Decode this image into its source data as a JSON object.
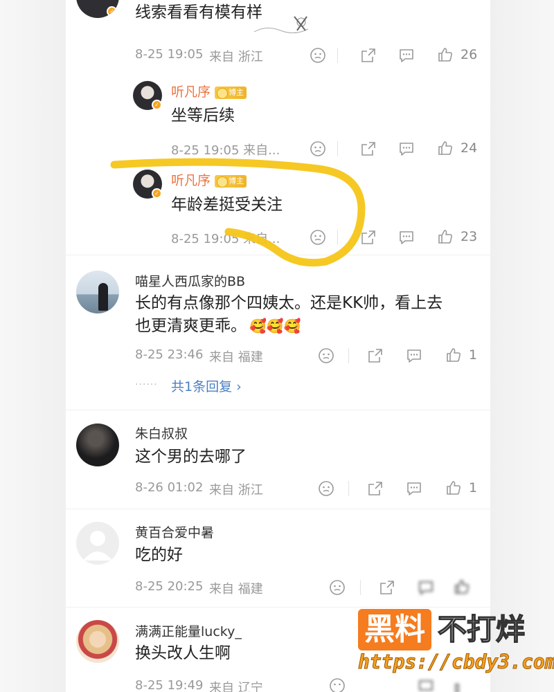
{
  "threads": {
    "top": {
      "comment": "线索看看有模有样",
      "time": "8-25 19:05",
      "from": "来自 浙江",
      "likes": "26"
    },
    "reply1": {
      "username": "听凡序",
      "badge": "博主",
      "comment": "坐等后续",
      "meta": "8-25 19:05 来自...",
      "likes": "24"
    },
    "reply2": {
      "username": "听凡序",
      "badge": "博主",
      "comment": "年龄差挺受关注",
      "meta": "8-25 19:05 来自...",
      "likes": "23"
    },
    "c1": {
      "username": "喵星人西瓜家的BB",
      "line1": "长的有点像那个四姨太。还是KK帅，看上去",
      "line2": "也更清爽更乖。",
      "emoji": "🥰🥰🥰",
      "time": "8-25 23:46",
      "from": "来自 福建",
      "likes": "1",
      "more_dots": "······",
      "more_replies": "共1条回复 ›"
    },
    "c2": {
      "username": "朱白叔叔",
      "comment": "这个男的去哪了",
      "time": "8-26 01:02",
      "from": "来自 浙江",
      "likes": "1"
    },
    "c3": {
      "username": "黄百合爱中暑",
      "comment": "吃的好",
      "time": "8-25 20:25",
      "from": "来自 福建"
    },
    "c4": {
      "username": "满满正能量lucky_",
      "comment": "换头改人生啊",
      "time": "8-25 19:49",
      "from": "来自 辽宁"
    }
  },
  "icons": {
    "reaction": "smiley-icon",
    "share": "share-icon",
    "comment": "comment-icon",
    "like": "thumbs-up-icon",
    "verified": "verified-badge-icon"
  },
  "colors": {
    "username_blogger": "#eb7340",
    "link": "#4a7fc1",
    "meta": "#999999",
    "annotation": "#f5c518",
    "watermark_orange": "#f57c1f"
  },
  "watermark": {
    "box": "黑料",
    "text": "不打烊",
    "url": "https://cbdy3.com"
  }
}
